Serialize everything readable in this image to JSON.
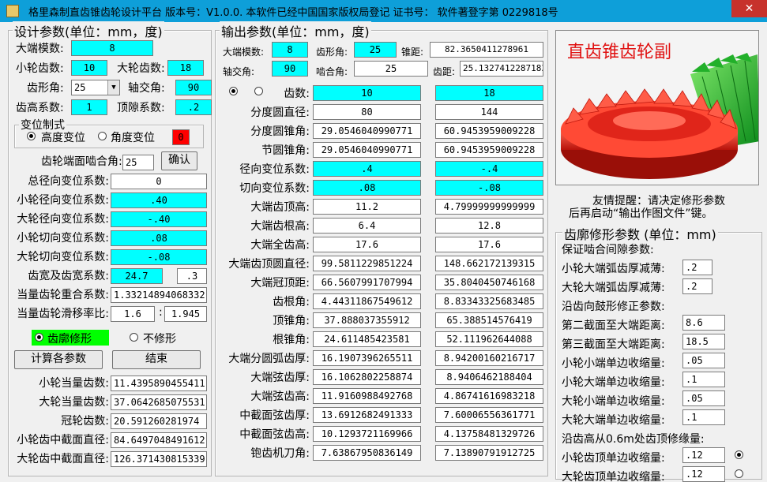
{
  "window": {
    "title": "格里森制直齿锥齿轮设计平台  版本号：V1.0.0.    本软件已经中国国家版权局登记  证书号：  软件著登字第 0229818号",
    "close": "✕"
  },
  "design": {
    "legend": "设计参数(单位：mm，度)",
    "module_label": "大端模数:",
    "module_value": "8",
    "z1_label": "小轮齿数:",
    "z1_value": "10",
    "z2_label": "大轮齿数:",
    "z2_value": "18",
    "alpha_label": "齿形角:",
    "alpha_value": "25",
    "sigma_label": "轴交角:",
    "sigma_value": "90",
    "ha_label": "齿高系数:",
    "ha_value": "1",
    "c_label": "顶隙系数:",
    "c_value": ".2",
    "shift_legend": "变位制式",
    "shift_height": "高度变位",
    "shift_angle": "角度变位",
    "shift_angle_value": "0",
    "mesh_angle_label": "齿轮端面啮合角:",
    "mesh_angle_value": "25",
    "confirm_button": "确认",
    "total_radial_label": "总径向变位系数:",
    "total_radial_value": "0",
    "x1_label": "小轮径向变位系数:",
    "x1_value": ".40",
    "x2_label": "大轮径向变位系数:",
    "x2_value": "-.40",
    "xt1_label": "小轮切向变位系数:",
    "xt1_value": ".08",
    "xt2_label": "大轮切向变位系数:",
    "xt2_value": "-.08",
    "width_label": "齿宽及齿宽系数:",
    "width_value": "24.7",
    "width_coef": ".3",
    "eps_label": "当量齿轮重合系数:",
    "eps_value": "1.33214894068332",
    "slide_label": "当量齿轮滑移率比:",
    "slide1": "1.6",
    "slide_sep": ":",
    "slide2": "1.945",
    "modify_on": "齿廓修形",
    "modify_off": "不修形",
    "calc_button": "计算各参数",
    "end_button": "结束",
    "zv1_label": "小轮当量齿数:",
    "zv1_value": "11.4395890455411",
    "zv2_label": "大轮当量齿数:",
    "zv2_value": "37.0642685075531",
    "zc_label": "冠轮齿数:",
    "zc_value": "20.591260281974",
    "dm1_label": "小轮齿中截面直径:",
    "dm1_value": "84.6497048491612",
    "dm2_label": "大轮齿中截面直径:",
    "dm2_value": "126.371430815339"
  },
  "output": {
    "legend": "输出参数(单位：mm，度)",
    "module_label": "大端模数:",
    "module_value": "8",
    "alpha_label": "齿形角:",
    "alpha_value": "25",
    "cone_label": "锥距:",
    "cone_value": "82.3650411278961",
    "sigma_label": "轴交角:",
    "sigma_value": "90",
    "mesh_label": "啮合角:",
    "mesh_value": "25",
    "pitch_label": "齿距:",
    "pitch_value": "25.1327412287183",
    "rows": [
      {
        "label": "齿数:",
        "v1": "10",
        "v2": "18",
        "cyan": true
      },
      {
        "label": "分度圆直径:",
        "v1": "80",
        "v2": "144",
        "cyan": false
      },
      {
        "label": "分度圆锥角:",
        "v1": "29.0546040990771",
        "v2": "60.9453959009228",
        "cyan": false
      },
      {
        "label": "节圆锥角:",
        "v1": "29.0546040990771",
        "v2": "60.9453959009228",
        "cyan": false
      },
      {
        "label": "径向变位系数:",
        "v1": ".4",
        "v2": "-.4",
        "cyan": true
      },
      {
        "label": "切向变位系数:",
        "v1": ".08",
        "v2": "-.08",
        "cyan": true
      },
      {
        "label": "大端齿顶高:",
        "v1": "11.2",
        "v2": "4.79999999999999",
        "cyan": false
      },
      {
        "label": "大端齿根高:",
        "v1": "6.4",
        "v2": "12.8",
        "cyan": false
      },
      {
        "label": "大端全齿高:",
        "v1": "17.6",
        "v2": "17.6",
        "cyan": false
      },
      {
        "label": "大端齿顶圆直径:",
        "v1": "99.5811229851224",
        "v2": "148.662172139315",
        "cyan": false
      },
      {
        "label": "大端冠顶距:",
        "v1": "66.5607991707994",
        "v2": "35.8040450746168",
        "cyan": false
      },
      {
        "label": "齿根角:",
        "v1": "4.44311867549612",
        "v2": "8.83343325683485",
        "cyan": false
      },
      {
        "label": "顶锥角:",
        "v1": "37.888037355912",
        "v2": "65.388514576419",
        "cyan": false
      },
      {
        "label": "根锥角:",
        "v1": "24.611485423581",
        "v2": "52.111962644088",
        "cyan": false
      },
      {
        "label": "大端分圆弧齿厚:",
        "v1": "16.1907396265511",
        "v2": "8.94200160216717",
        "cyan": false
      },
      {
        "label": "大端弦齿厚:",
        "v1": "16.1062802258874",
        "v2": "8.9406462188404",
        "cyan": false
      },
      {
        "label": "大端弦齿高:",
        "v1": "11.9160988492768",
        "v2": "4.86741616983218",
        "cyan": false
      },
      {
        "label": "中截面弦齿厚:",
        "v1": "13.6912682491333",
        "v2": "7.60006556361771",
        "cyan": false
      },
      {
        "label": "中截面弦齿高:",
        "v1": "10.1293721169966",
        "v2": "4.13758481329726",
        "cyan": false
      },
      {
        "label": "铇齿机刀角:",
        "v1": "7.63867950836149",
        "v2": "7.13890791912725",
        "cyan": false
      }
    ]
  },
  "image": {
    "title": "直齿锥齿轮副"
  },
  "tip": {
    "line1": "友情提醒：请决定修形参数",
    "line2": "后再启动“输出作图文件”键。"
  },
  "modify": {
    "legend": "齿廓修形参数 (单位：mm)",
    "line1": "保证啮合间隙参数:",
    "l2": "小轮大端弧齿厚减薄:",
    "v2": ".2",
    "l3": "大轮大端弧齿厚减薄:",
    "v3": ".2",
    "line4": "沿齿向鼓形修正参数:",
    "l5": "第二截面至大端距离:",
    "v5": "8.6",
    "l6": "第三截面至大端距离:",
    "v6": "18.5",
    "l7": "小轮小端单边收缩量:",
    "v7": ".05",
    "l8": "小轮大端单边收缩量:",
    "v8": ".1",
    "l9": "大轮小端单边收缩量:",
    "v9": ".05",
    "l10": "大轮大端单边收缩量:",
    "v10": ".1",
    "line11": "沿齿高从0.6m处齿顶修缘量:",
    "l12": "小轮齿顶单边收缩量:",
    "v12": ".12",
    "l13": "大轮齿顶单边收缩量:",
    "v13": ".12"
  },
  "colors": {
    "titlebar": "#0e9fd9",
    "field_cyan": "#00ffff",
    "alert_red": "#ff0000",
    "green_toggle": "#00ff00"
  }
}
